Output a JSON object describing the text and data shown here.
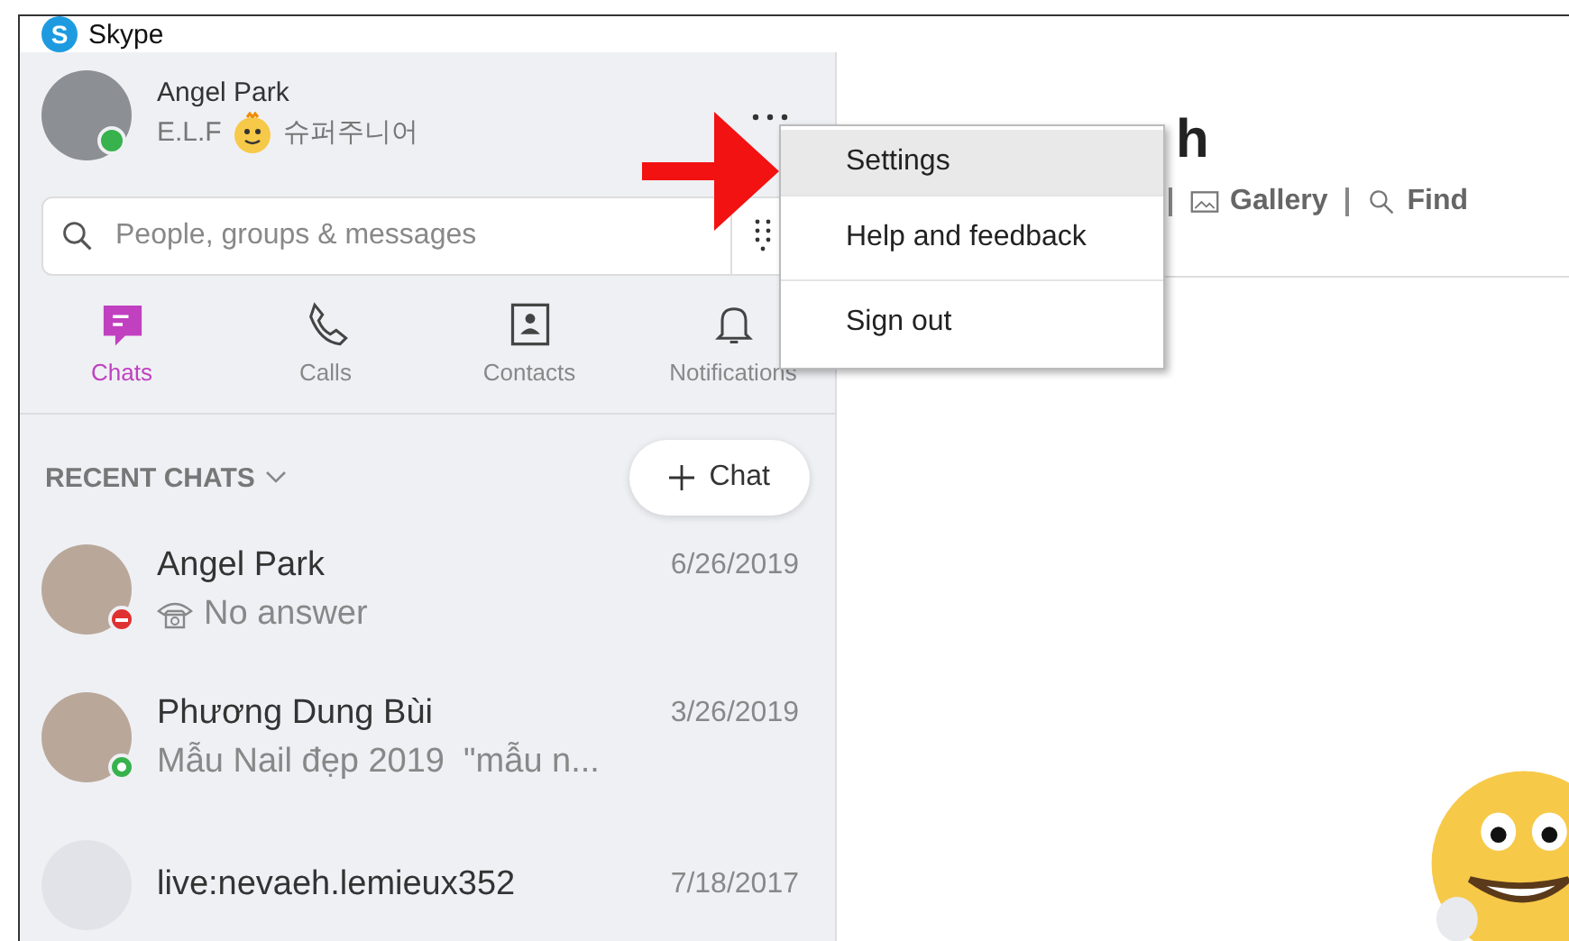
{
  "window": {
    "title": "Skype",
    "logo_letter": "S"
  },
  "profile": {
    "name": "Angel Park",
    "status_prefix": "E.L.F",
    "status_suffix": "슈퍼주니어",
    "color": "#37b24d"
  },
  "search": {
    "placeholder": "People, groups & messages"
  },
  "nav_tabs": [
    {
      "label": "Chats",
      "kind": "chat",
      "selected": true
    },
    {
      "label": "Calls",
      "kind": "call",
      "selected": false
    },
    {
      "label": "Contacts",
      "kind": "contacts",
      "selected": false
    },
    {
      "label": "Notifications",
      "kind": "bell",
      "selected": false
    }
  ],
  "recent": {
    "heading": "RECENT CHATS",
    "new_chat_label": "Chat"
  },
  "chats": [
    {
      "name": "Angel Park",
      "date": "6/26/2019",
      "preview": "No answer",
      "kind": "missed_call",
      "color": "#e03131"
    },
    {
      "name": "Phương Dung Bùi",
      "date": "3/26/2019",
      "preview": "Mẫu Nail đẹp 2019  \"mẫu n...",
      "kind": "message",
      "color": "#37b24d"
    },
    {
      "name": "live:nevaeh.lemieux352",
      "date": "7/18/2017"
    }
  ],
  "conversation": {
    "title_fragment": "h",
    "toolbar": [
      {
        "label": "Gallery",
        "kind": "gallery"
      },
      {
        "label": "Find",
        "kind": "search"
      }
    ]
  },
  "menu": {
    "items": [
      {
        "label": "Settings",
        "selected": true
      },
      {
        "label": "Help and feedback",
        "selected": false
      },
      {
        "label": "Sign out",
        "selected": false
      }
    ]
  }
}
